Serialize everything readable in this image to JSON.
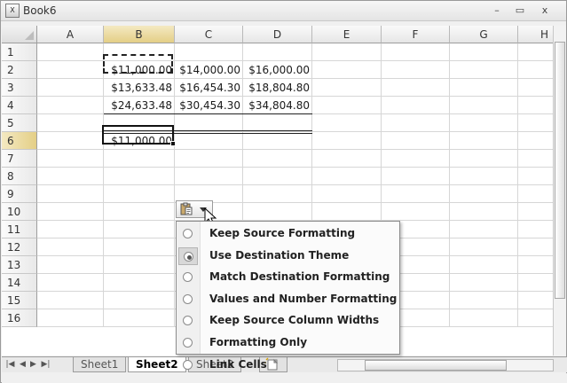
{
  "window": {
    "title": "Book6",
    "app_icon": "excel-icon",
    "buttons": {
      "minimize": "–",
      "maximize": "▭",
      "close": "x"
    }
  },
  "columns": [
    "A",
    "B",
    "C",
    "D",
    "E",
    "F",
    "G",
    "H"
  ],
  "rows": [
    "1",
    "2",
    "3",
    "4",
    "5",
    "6",
    "7",
    "8",
    "9",
    "10",
    "11",
    "12",
    "13",
    "14",
    "15",
    "16"
  ],
  "cells": {
    "B2": "$11,000.00",
    "C2": "$14,000.00",
    "D2": "$16,000.00",
    "B3": "$13,633.48",
    "C3": "$16,454.30",
    "D3": "$18,804.80",
    "B4": "$24,633.48",
    "C4": "$30,454.30",
    "D4": "$34,804.80",
    "B6": "$11,000.00"
  },
  "paste_options": {
    "icon": "clipboard-icon",
    "items": [
      {
        "label": "Keep Source Formatting",
        "checked": false
      },
      {
        "label": "Use Destination Theme",
        "checked": true
      },
      {
        "label": "Match Destination Formatting",
        "checked": false
      },
      {
        "label": "Values and Number Formatting",
        "checked": false
      },
      {
        "label": "Keep Source Column Widths",
        "checked": false
      },
      {
        "label": "Formatting Only",
        "checked": false
      },
      {
        "label": "Link Cells",
        "checked": false
      }
    ]
  },
  "sheets": {
    "tabs": [
      "Sheet1",
      "Sheet2",
      "Sheet3"
    ],
    "active": "Sheet2",
    "nav_icons": [
      "first-sheet-icon",
      "prev-sheet-icon",
      "next-sheet-icon",
      "last-sheet-icon"
    ]
  },
  "colors": {
    "selected_header": "#e4cf86",
    "grid_line": "#d6d6d6"
  }
}
